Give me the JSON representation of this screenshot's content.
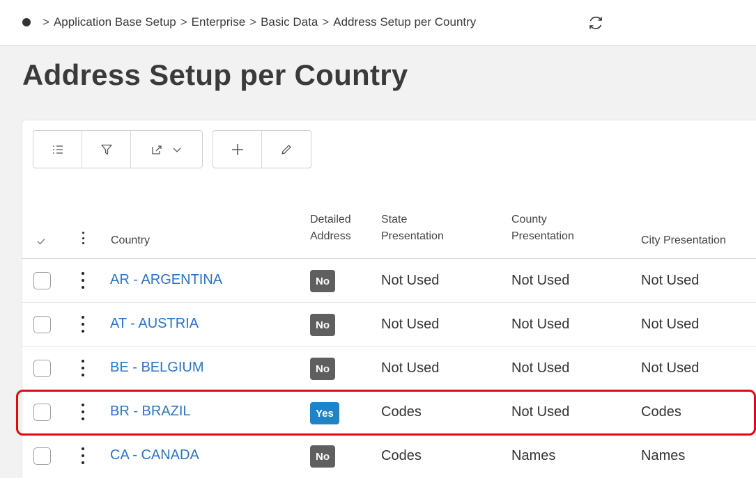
{
  "breadcrumb": {
    "items": [
      "Application Base Setup",
      "Enterprise",
      "Basic Data",
      "Address Setup per Country"
    ],
    "separator": ">"
  },
  "page": {
    "title": "Address Setup per Country"
  },
  "table": {
    "columns": {
      "country": "Country",
      "detailed_address_1": "Detailed",
      "detailed_address_2": "Address",
      "state_1": "State",
      "state_2": "Presentation",
      "county_1": "County",
      "county_2": "Presentation",
      "city": "City Presentation"
    },
    "rows": [
      {
        "country": "AR - ARGENTINA",
        "detailed": "No",
        "state": "Not Used",
        "county": "Not Used",
        "city": "Not Used"
      },
      {
        "country": "AT - AUSTRIA",
        "detailed": "No",
        "state": "Not Used",
        "county": "Not Used",
        "city": "Not Used"
      },
      {
        "country": "BE - BELGIUM",
        "detailed": "No",
        "state": "Not Used",
        "county": "Not Used",
        "city": "Not Used"
      },
      {
        "country": "BR - BRAZIL",
        "detailed": "Yes",
        "state": "Codes",
        "county": "Not Used",
        "city": "Codes"
      },
      {
        "country": "CA - CANADA",
        "detailed": "No",
        "state": "Codes",
        "county": "Names",
        "city": "Names"
      }
    ]
  },
  "colors": {
    "link": "#2a74c3",
    "badge_no": "#5f5f5f",
    "badge_yes": "#1e84c7",
    "highlight": "#e30613"
  },
  "icons": [
    "home-dot-icon",
    "refresh-icon",
    "list-view-icon",
    "filter-icon",
    "export-icon",
    "chevron-down-icon",
    "add-icon",
    "edit-icon",
    "select-all-check-icon",
    "column-menu-icon",
    "row-menu-icon"
  ]
}
